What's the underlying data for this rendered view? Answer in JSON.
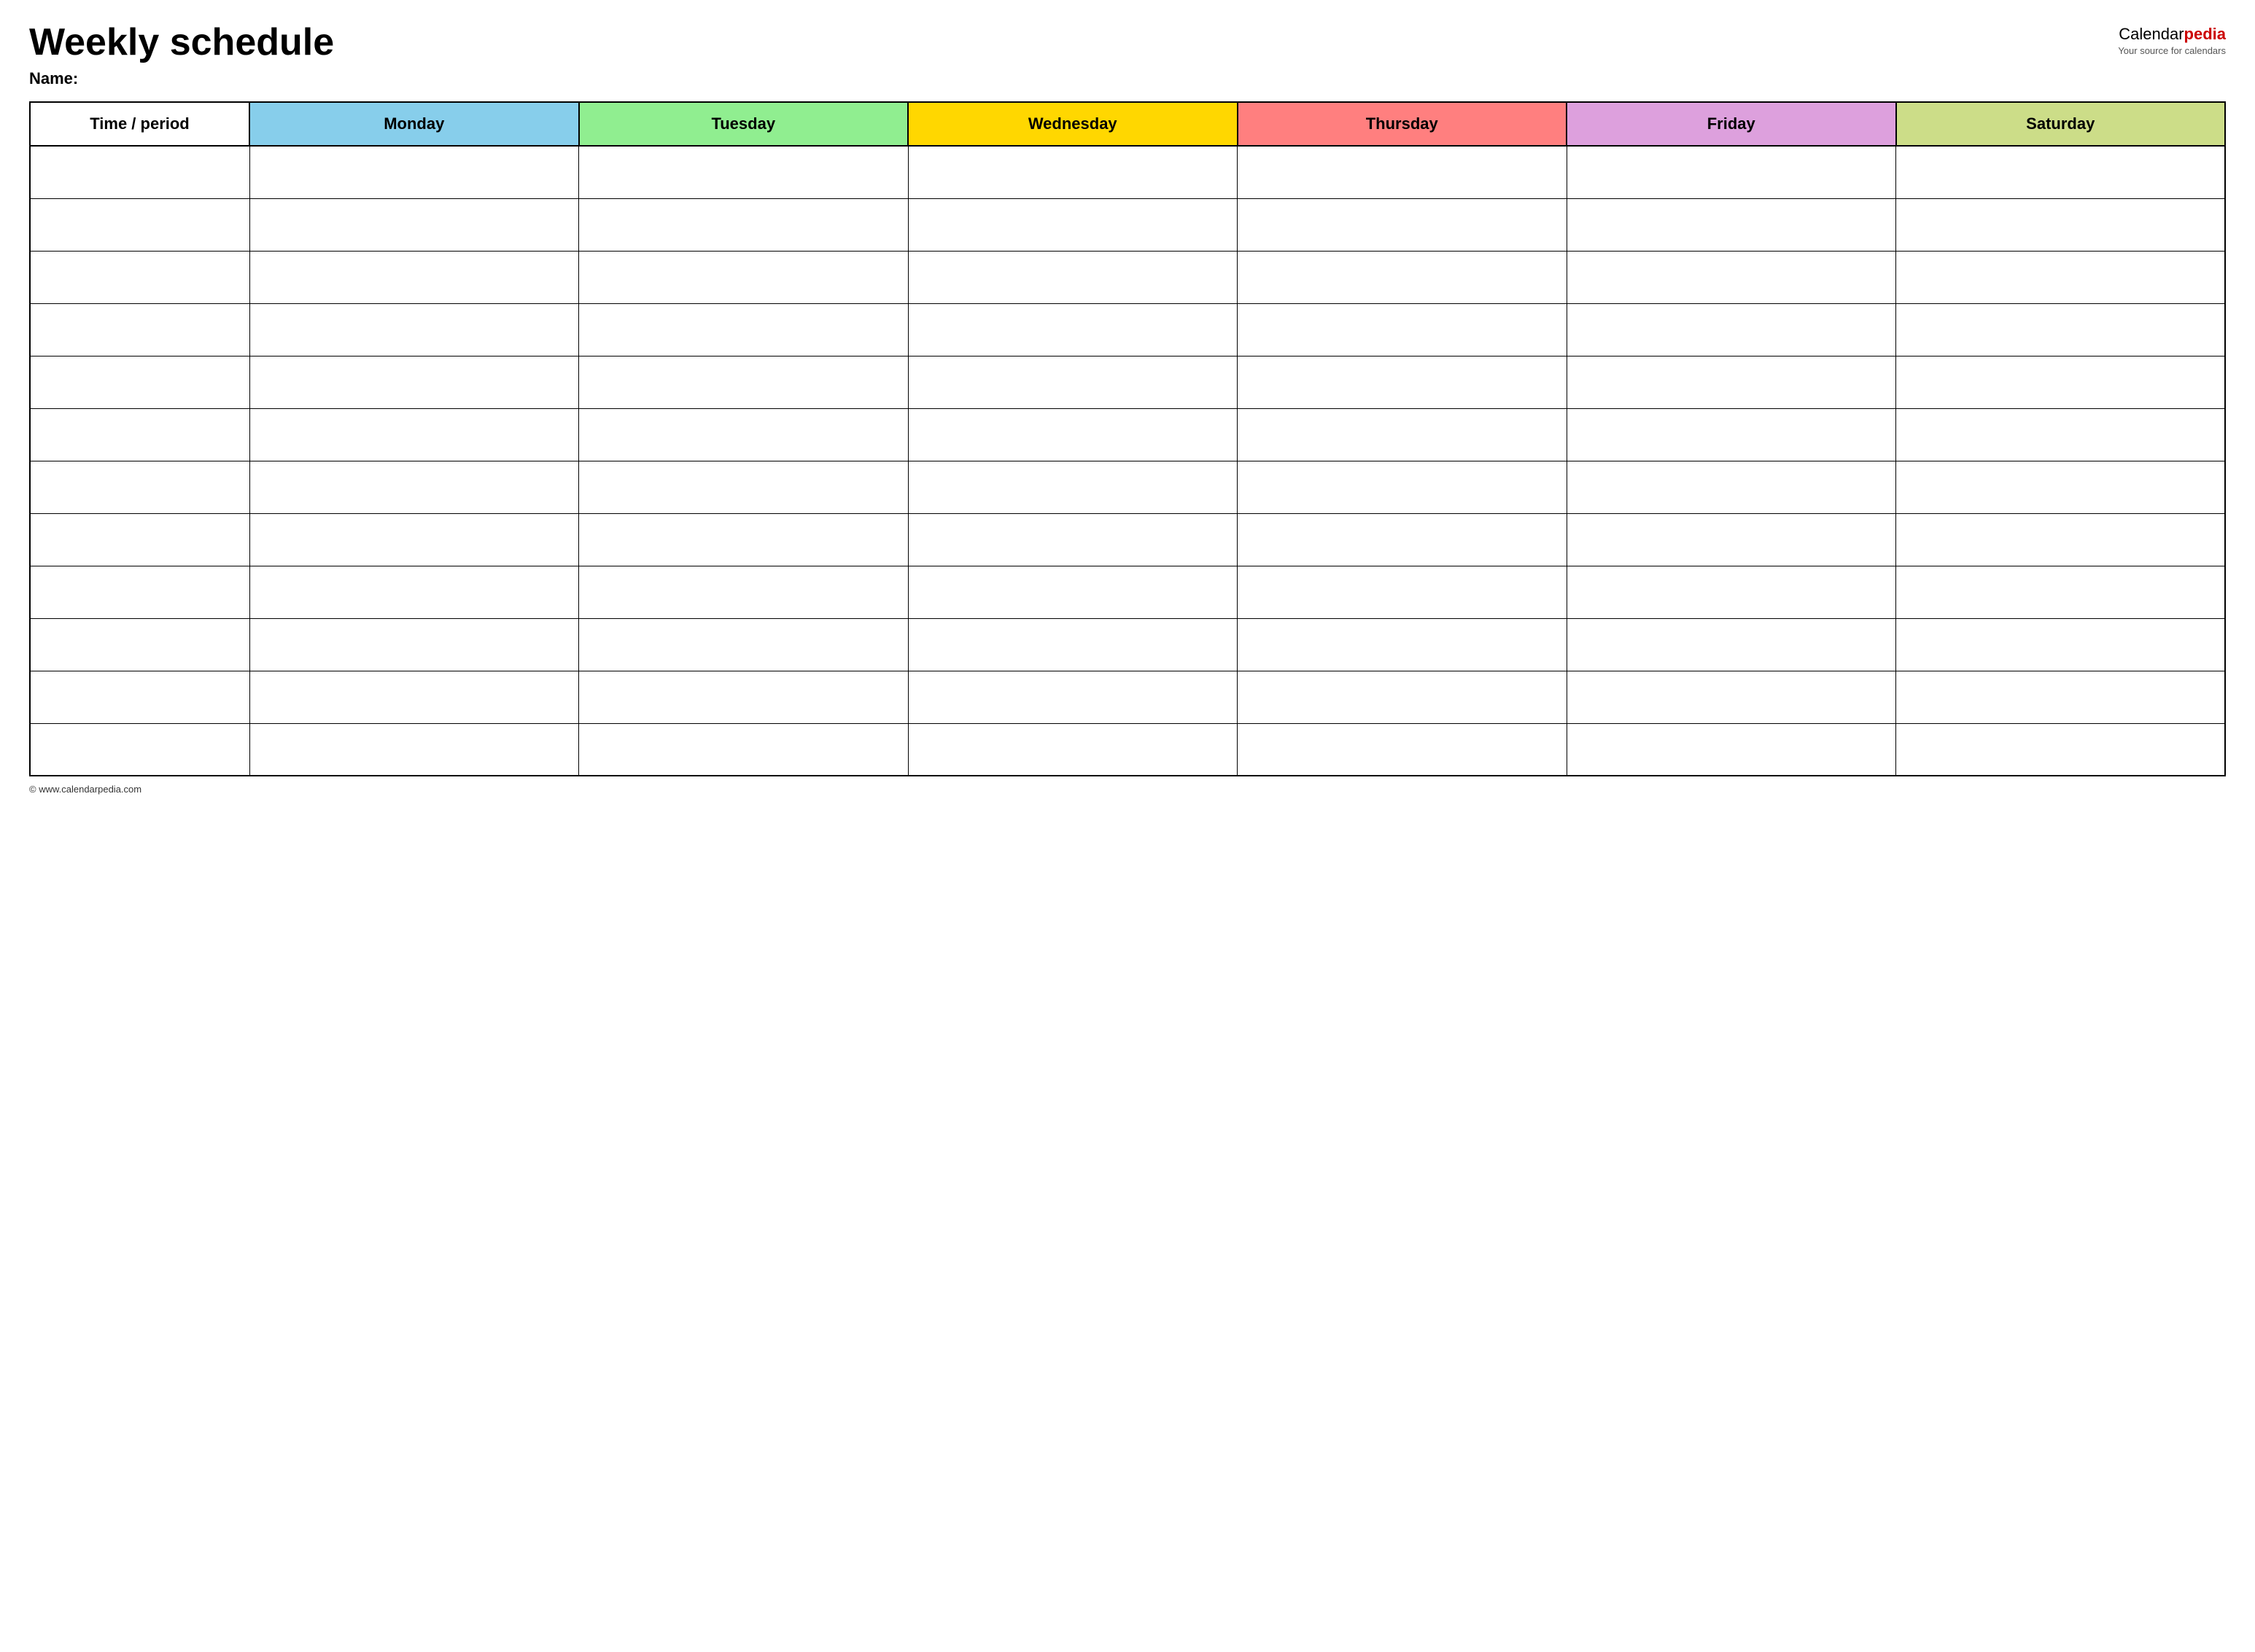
{
  "header": {
    "title": "Weekly schedule",
    "name_label": "Name:",
    "logo_calendar": "Calendar",
    "logo_pedia": "pedia",
    "logo_tagline": "Your source for calendars"
  },
  "table": {
    "columns": [
      {
        "key": "time",
        "label": "Time / period",
        "color_class": "col-time"
      },
      {
        "key": "monday",
        "label": "Monday",
        "color_class": "col-monday"
      },
      {
        "key": "tuesday",
        "label": "Tuesday",
        "color_class": "col-tuesday"
      },
      {
        "key": "wednesday",
        "label": "Wednesday",
        "color_class": "col-wednesday"
      },
      {
        "key": "thursday",
        "label": "Thursday",
        "color_class": "col-thursday"
      },
      {
        "key": "friday",
        "label": "Friday",
        "color_class": "col-friday"
      },
      {
        "key": "saturday",
        "label": "Saturday",
        "color_class": "col-saturday"
      }
    ],
    "row_count": 12
  },
  "footer": {
    "url": "© www.calendarpedia.com"
  }
}
